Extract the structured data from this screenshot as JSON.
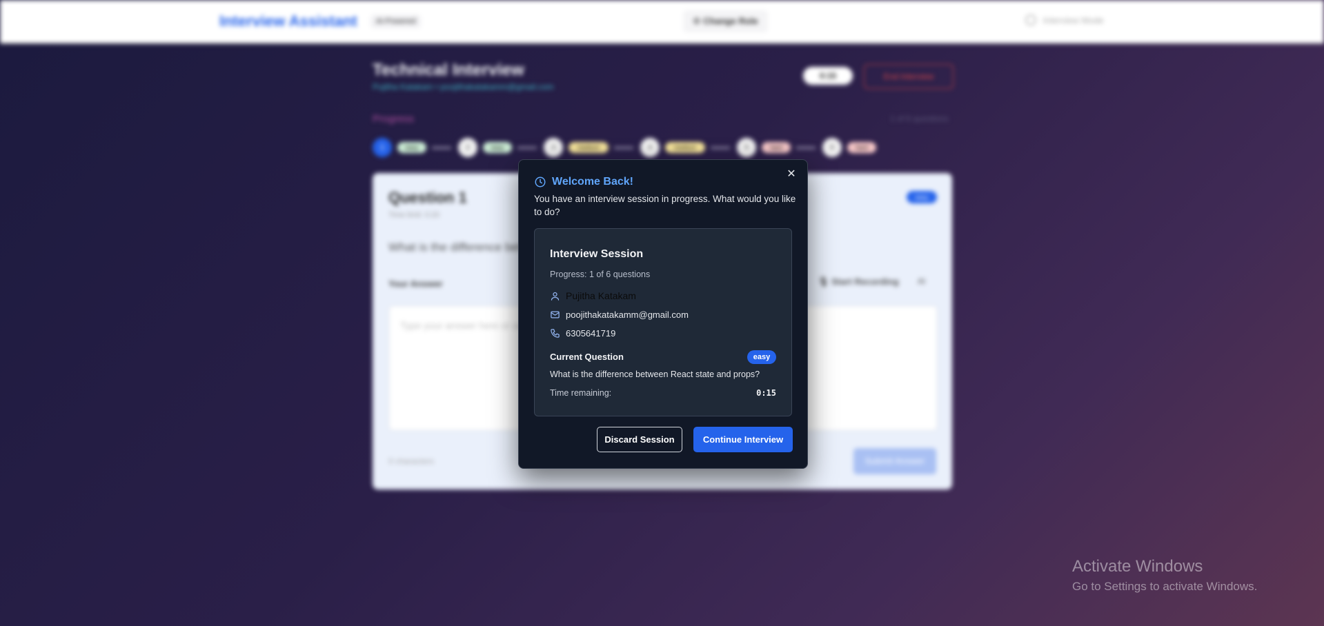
{
  "header": {
    "brand": "Interview Assistant",
    "ai_chip": "AI-Powered",
    "change_role": "Change Role",
    "mode": "Interview Mode"
  },
  "interview": {
    "title": "Technical Interview",
    "subtitle": "Pujitha Katakam • poojithakatakamm@gmail.com",
    "timer": "0:15",
    "end_button": "End Interview",
    "progress_label": "Progress",
    "progress_count": "1 of 6 questions",
    "steps": [
      {
        "num": "1",
        "level": "easy",
        "color": "#2563eb",
        "pill_bg": "#cdeed6"
      },
      {
        "num": "2",
        "level": "easy",
        "color": "#f2f2f2",
        "pill_bg": "#cdeed6"
      },
      {
        "num": "3",
        "level": "medium",
        "color": "#f2f2f2",
        "pill_bg": "#f5e39a"
      },
      {
        "num": "4",
        "level": "medium",
        "color": "#f2f2f2",
        "pill_bg": "#f5e39a"
      },
      {
        "num": "5",
        "level": "hard",
        "color": "#f2f2f2",
        "pill_bg": "#f7c8c8"
      },
      {
        "num": "6",
        "level": "hard",
        "color": "#f2f2f2",
        "pill_bg": "#f7c8c8"
      }
    ]
  },
  "question_card": {
    "title": "Question 1",
    "time_limit": "Time limit: 0:20",
    "badge": "easy",
    "question": "What is the difference between React state and props?",
    "answer_label": "Your Answer",
    "record_label": "Start Recording",
    "ai_label": "AI",
    "placeholder": "Type your answer here or use voice recording...",
    "char_count": "0 characters",
    "submit_label": "Submit Answer"
  },
  "modal": {
    "title": "Welcome Back!",
    "description": "You have an interview session in progress. What would you like to do?",
    "session_title": "Interview Session",
    "progress": "Progress: 1 of 6 questions",
    "name": "Pujitha Katakam",
    "email": "poojithakatakamm@gmail.com",
    "phone": "6305641719",
    "current_question_label": "Current Question",
    "difficulty": "easy",
    "current_question": "What is the difference between React state and props?",
    "time_remaining_label": "Time remaining:",
    "time_remaining": "0:15",
    "discard_label": "Discard Session",
    "continue_label": "Continue Interview",
    "colors": {
      "accent": "#2563eb",
      "title": "#60a5fa",
      "bg": "#111827",
      "card": "#1f2937"
    }
  },
  "watermark": {
    "title": "Activate Windows",
    "subtitle": "Go to Settings to activate Windows."
  }
}
